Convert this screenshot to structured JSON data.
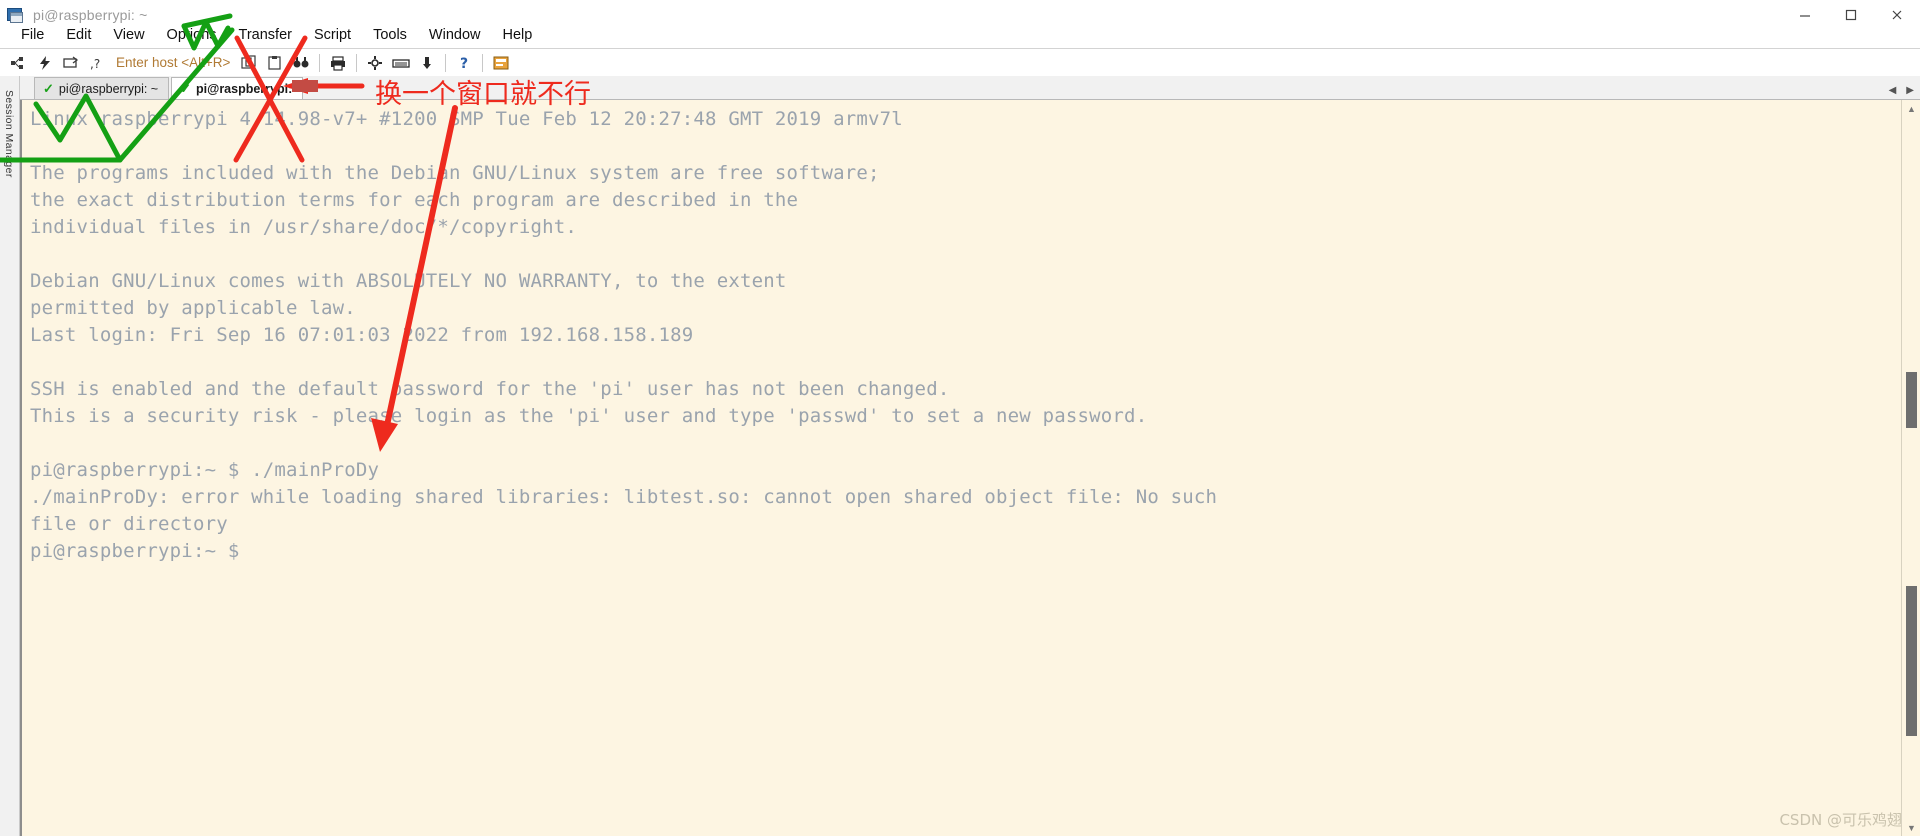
{
  "window": {
    "title": "pi@raspberrypi: ~",
    "icon": "securecrt-terminal-icon",
    "controls": {
      "minimize": "minimize-icon",
      "maximize": "maximize-icon",
      "close": "close-icon"
    }
  },
  "menubar": {
    "items": [
      {
        "label": "File"
      },
      {
        "label": "Edit"
      },
      {
        "label": "View"
      },
      {
        "label": "Options"
      },
      {
        "label": "Transfer"
      },
      {
        "label": "Script"
      },
      {
        "label": "Tools"
      },
      {
        "label": "Window"
      },
      {
        "label": "Help"
      }
    ]
  },
  "toolbar": {
    "host_placeholder": "Enter host <Alt+R>",
    "buttons": [
      {
        "name": "connect-icon"
      },
      {
        "name": "quick-connect-icon"
      },
      {
        "name": "connect-in-tab-icon"
      },
      {
        "name": "connect-sftp-icon"
      },
      {
        "name": "clone-session-icon"
      },
      {
        "name": "paste-icon"
      },
      {
        "name": "find-icon"
      },
      {
        "name": "print-icon"
      },
      {
        "name": "session-options-icon"
      },
      {
        "name": "keymap-editor-icon"
      },
      {
        "name": "log-session-icon"
      },
      {
        "name": "help-icon"
      },
      {
        "name": "chat-window-icon"
      }
    ]
  },
  "sidebar": {
    "label": "Session Manager"
  },
  "tabs": {
    "items": [
      {
        "label": "pi@raspberrypi: ~",
        "active": false,
        "status": "connected"
      },
      {
        "label": "pi@raspberrypi:",
        "active": true,
        "status": "connected"
      }
    ],
    "nav_left": "◀",
    "nav_right": "▶"
  },
  "terminal": {
    "lines": [
      "Linux raspberrypi 4.14.98-v7+ #1200 SMP Tue Feb 12 20:27:48 GMT 2019 armv7l",
      "",
      "The programs included with the Debian GNU/Linux system are free software;",
      "the exact distribution terms for each program are described in the",
      "individual files in /usr/share/doc/*/copyright.",
      "",
      "Debian GNU/Linux comes with ABSOLUTELY NO WARRANTY, to the extent",
      "permitted by applicable law.",
      "Last login: Fri Sep 16 07:01:03 2022 from 192.168.158.189",
      "",
      "SSH is enabled and the default password for the 'pi' user has not been changed.",
      "This is a security risk - please login as the 'pi' user and type 'passwd' to set a new password.",
      "",
      "pi@raspberrypi:~ $ ./mainProDy",
      "./mainProDy: error while loading shared libraries: libtest.so: cannot open shared object file: No such",
      "file or directory",
      "pi@raspberrypi:~ $"
    ],
    "background_color": "#fdf5e2",
    "text_color": "#9aa3ad"
  },
  "annotations": {
    "note_text": "换一个窗口就不行",
    "note_color": "#ee2a1e",
    "check_color": "#14a014",
    "arrow_color": "#ee2a1e"
  },
  "watermark": {
    "text": "CSDN @可乐鸡翅"
  }
}
